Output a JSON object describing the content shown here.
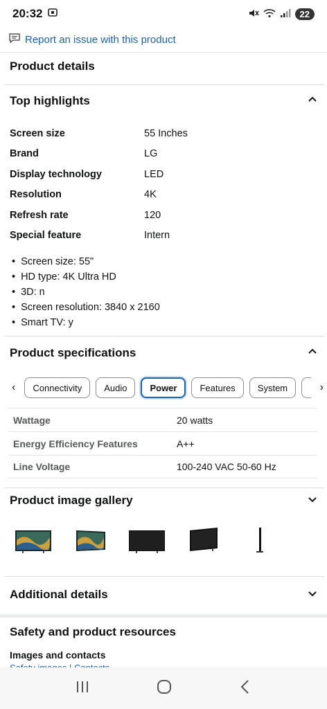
{
  "status": {
    "time": "20:32",
    "battery": "22"
  },
  "report": {
    "link": "Report an issue with this product"
  },
  "product_details": {
    "title": "Product details"
  },
  "top_highlights": {
    "title": "Top highlights",
    "rows": [
      {
        "key": "Screen size",
        "value": "55 Inches"
      },
      {
        "key": "Brand",
        "value": "LG"
      },
      {
        "key": "Display technology",
        "value": "LED"
      },
      {
        "key": "Resolution",
        "value": "4K"
      },
      {
        "key": "Refresh rate",
        "value": "120"
      },
      {
        "key": "Special feature",
        "value": "Intern"
      }
    ],
    "bullets": [
      "Screen size: 55\"",
      "HD type: 4K Ultra HD",
      "3D: n",
      "Screen resolution: 3840 x 2160",
      "Smart TV: y"
    ]
  },
  "specs": {
    "title": "Product specifications",
    "tabs": [
      "Connectivity",
      "Audio",
      "Power",
      "Features",
      "System"
    ],
    "active_tab": "Power",
    "rows": [
      {
        "key": "Wattage",
        "value": "20 watts"
      },
      {
        "key": "Energy Efficiency Features",
        "value": "A++"
      },
      {
        "key": "Line Voltage",
        "value": "100-240 VAC 50-60 Hz"
      }
    ]
  },
  "gallery": {
    "title": "Product image gallery",
    "count": 5
  },
  "additional": {
    "title": "Additional details"
  },
  "safety": {
    "title": "Safety and product resources",
    "subtitle": "Images and contacts",
    "links": "Safety images | Contacts"
  },
  "colors": {
    "link": "#2162a1",
    "active_tab_border": "#2162a1"
  }
}
